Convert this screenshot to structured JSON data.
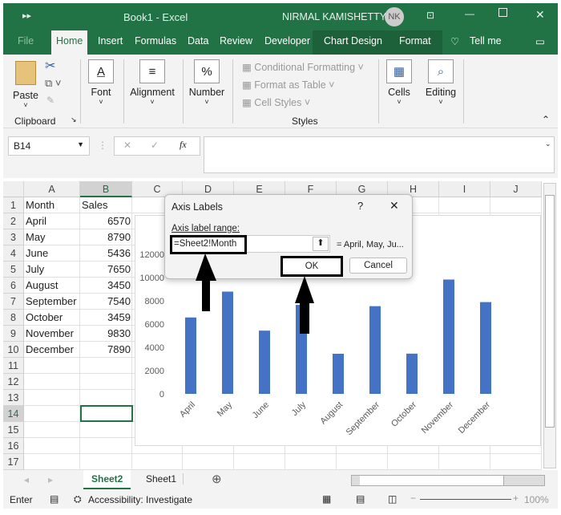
{
  "window": {
    "title": "Book1  -  Excel",
    "user": "NIRMAL KAMISHETTY",
    "avatar": "NK"
  },
  "tabs": [
    "File",
    "Home",
    "Insert",
    "Formulas",
    "Data",
    "Review",
    "Developer",
    "Chart Design",
    "Format",
    "Tell me"
  ],
  "ribbon": {
    "paste": "Paste",
    "font": "Font",
    "alignment": "Alignment",
    "number": "Number",
    "conditional": "Conditional Formatting ˅",
    "format_table": "Format as Table ˅",
    "cell_styles": "Cell Styles ˅",
    "cells": "Cells",
    "editing": "Editing",
    "clipboard": "Clipboard",
    "styles": "Styles"
  },
  "formula_bar": {
    "name_box": "B14",
    "fx": "fx",
    "value": ""
  },
  "columns": [
    "A",
    "B",
    "C",
    "D",
    "E",
    "F",
    "G",
    "H",
    "I",
    "J"
  ],
  "rows": [
    "1",
    "2",
    "3",
    "4",
    "5",
    "6",
    "7",
    "8",
    "9",
    "10",
    "11",
    "12",
    "13",
    "14",
    "15",
    "16",
    "17"
  ],
  "table": {
    "headers": [
      "Month",
      "Sales"
    ],
    "rows": [
      [
        "April",
        "6570"
      ],
      [
        "May",
        "8790"
      ],
      [
        "June",
        "5436"
      ],
      [
        "July",
        "7650"
      ],
      [
        "August",
        "3450"
      ],
      [
        "September",
        "7540"
      ],
      [
        "October",
        "3459"
      ],
      [
        "November",
        "9830"
      ],
      [
        "December",
        "7890"
      ]
    ]
  },
  "chart_data": {
    "type": "bar",
    "categories": [
      "April",
      "May",
      "June",
      "July",
      "August",
      "September",
      "October",
      "November",
      "December"
    ],
    "values": [
      6570,
      8790,
      5436,
      7650,
      3450,
      7540,
      3459,
      9830,
      7890
    ],
    "yticks": [
      "0",
      "2000",
      "4000",
      "6000",
      "8000",
      "10000",
      "12000"
    ],
    "ylim": [
      0,
      12000
    ],
    "color": "#4472c4"
  },
  "dialog": {
    "title": "Axis Labels",
    "help": "?",
    "close": "✕",
    "label": "Axis label range:",
    "value": "=Sheet2!Month",
    "preview": "= April, May, Ju...",
    "ok": "OK",
    "cancel": "Cancel"
  },
  "sheets": [
    "Sheet2",
    "Sheet1"
  ],
  "status": {
    "mode": "Enter",
    "accessibility": "Accessibility: Investigate",
    "zoom": "100%"
  }
}
